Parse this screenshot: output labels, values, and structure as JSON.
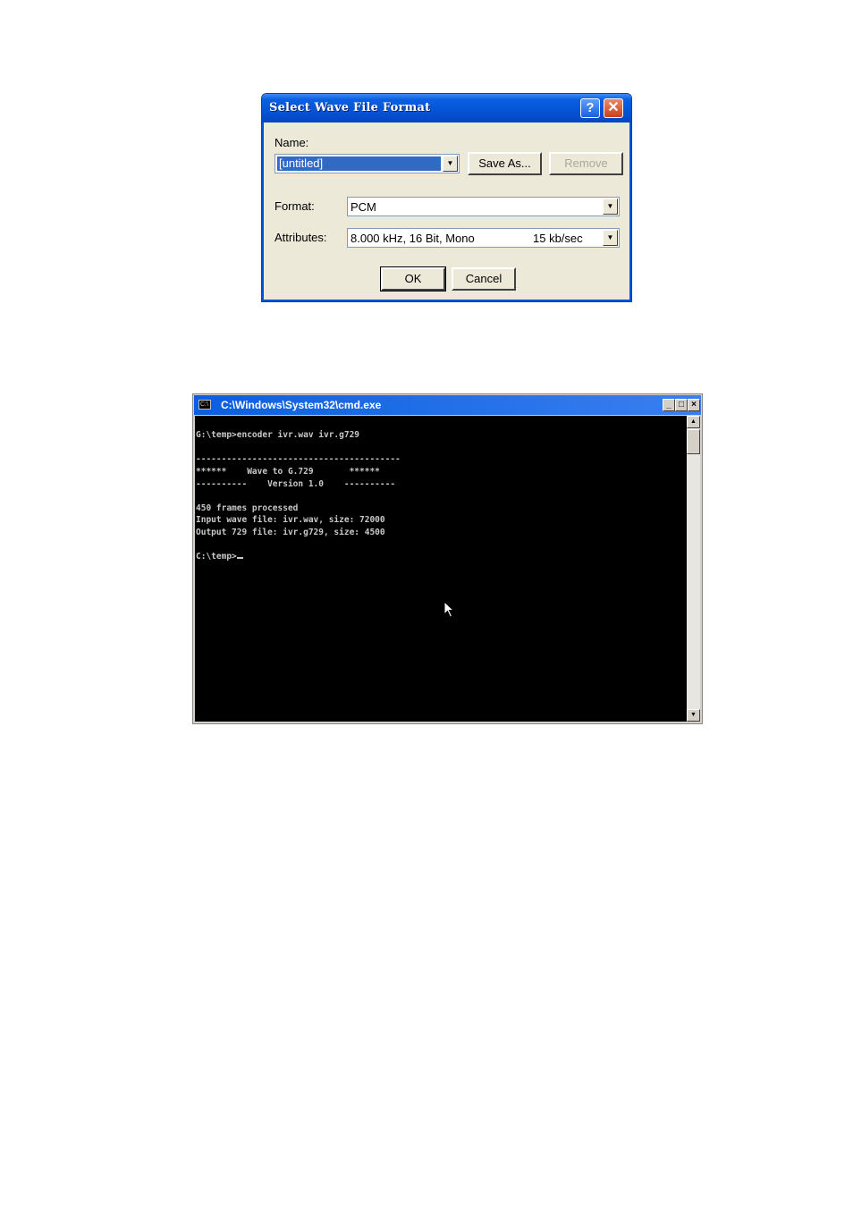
{
  "dialog": {
    "title": "Select Wave File Format",
    "help_glyph": "?",
    "close_glyph": "✕",
    "name_label": "Name:",
    "name_value": "[untitled]",
    "save_as_label": "Save As...",
    "remove_label": "Remove",
    "format_label": "Format:",
    "format_value": "PCM",
    "attributes_label": "Attributes:",
    "attributes_value": "8.000 kHz, 16 Bit, Mono",
    "attributes_rate": "15 kb/sec",
    "ok_label": "OK",
    "cancel_label": "Cancel",
    "dropdown_glyph": "▼",
    "remove_enabled": false
  },
  "cmd": {
    "title": "C:\\Windows\\System32\\cmd.exe",
    "icon_glyph": "C:\\",
    "minimize_glyph": "_",
    "maximize_glyph": "□",
    "close_glyph": "×",
    "scroll_up_glyph": "▲",
    "scroll_down_glyph": "▼",
    "lines": [
      "G:\\temp>encoder ivr.wav ivr.g729",
      "",
      "----------------------------------------",
      "******    Wave to G.729       ******",
      "----------    Version 1.0    ----------",
      "",
      "450 frames processed",
      "Input wave file: ivr.wav, size: 72000",
      "Output 729 file: ivr.g729, size: 4500",
      "",
      "C:\\temp>"
    ]
  }
}
